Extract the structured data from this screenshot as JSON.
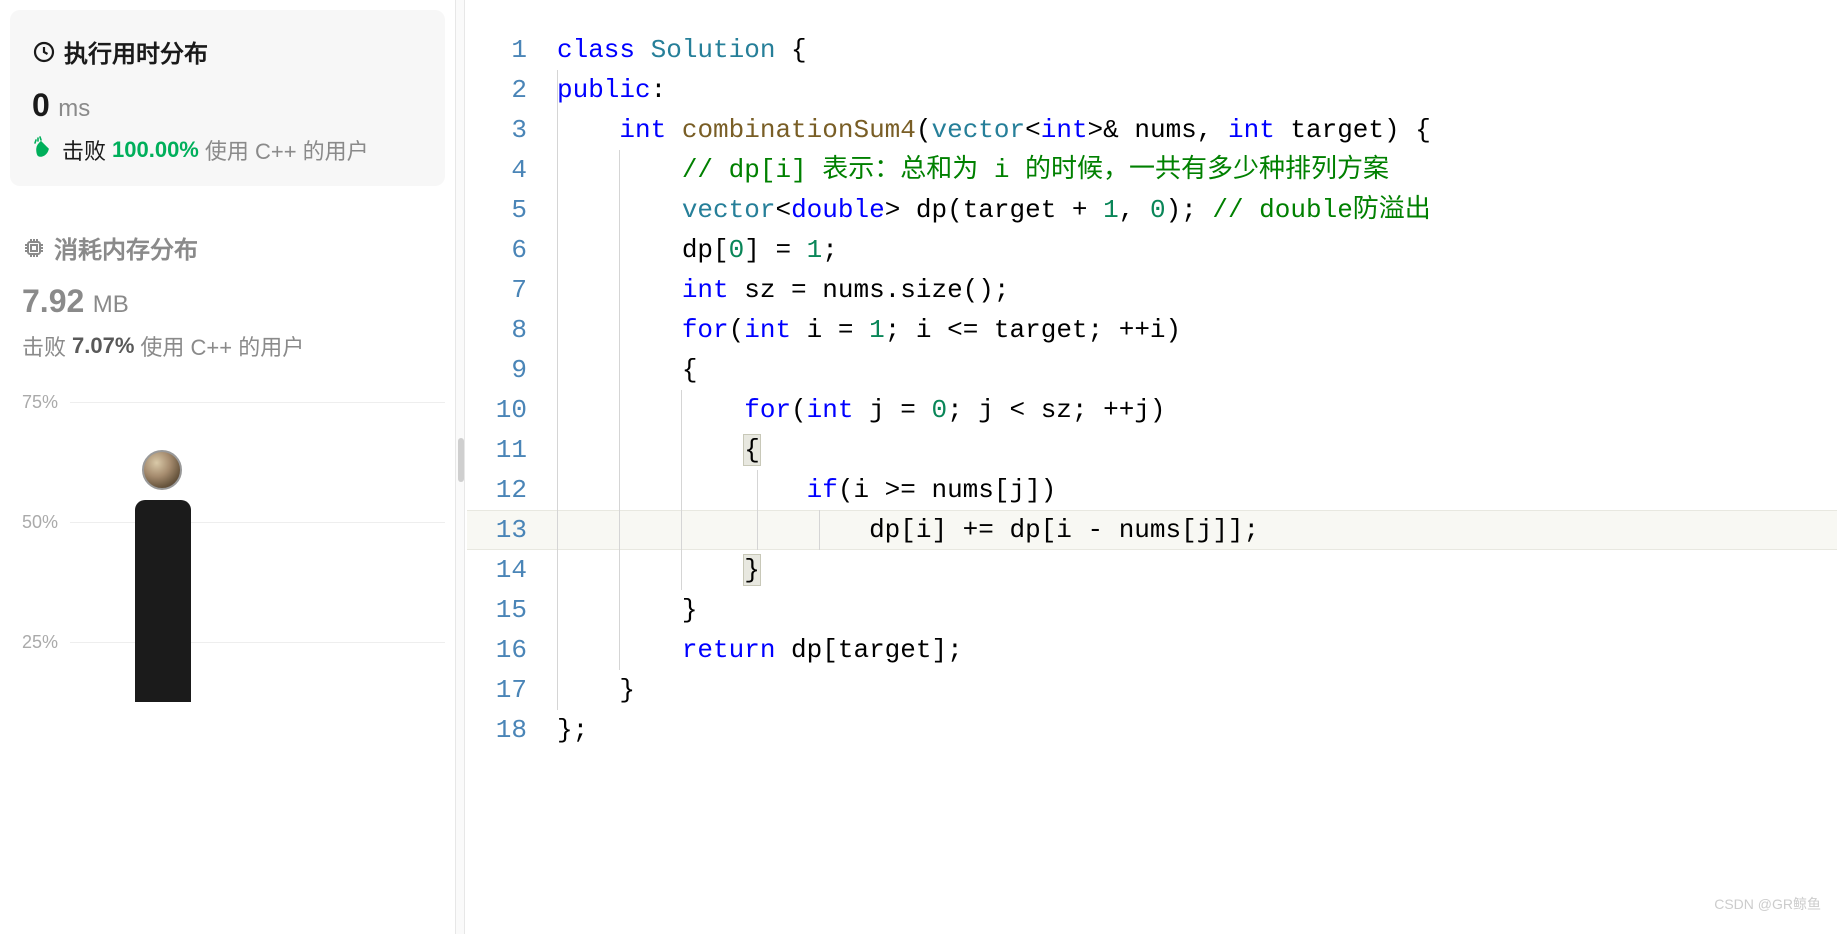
{
  "sidebar": {
    "runtime": {
      "title": "执行用时分布",
      "value": "0",
      "unit": "ms",
      "beats_label": "击败",
      "beats_pct": "100.00%",
      "beats_rest": "使用 C++ 的用户"
    },
    "memory": {
      "title": "消耗内存分布",
      "value": "7.92",
      "unit": "MB",
      "beats_label": "击败",
      "beats_pct": "7.07%",
      "beats_rest": "使用 C++ 的用户"
    },
    "chart": {
      "ticks": [
        "75%",
        "50%",
        "25%"
      ]
    }
  },
  "code": {
    "lines": {
      "l1": "1",
      "l2": "2",
      "l3": "3",
      "l4": "4",
      "l5": "5",
      "l6": "6",
      "l7": "7",
      "l8": "8",
      "l9": "9",
      "l10": "10",
      "l11": "11",
      "l12": "12",
      "l13": "13",
      "l14": "14",
      "l15": "15",
      "l16": "16",
      "l17": "17",
      "l18": "18"
    },
    "tokens": {
      "class": "class",
      "Solution": "Solution",
      "obrace": " {",
      "public": "public",
      "colon": ":",
      "int": "int",
      "fn": "combinationSum4",
      "vector": "vector",
      "lt": "<",
      "gt": ">",
      "amp_nums": "& nums, ",
      "target_decl": " target) {",
      "comment1": "// dp[i] 表示：总和为 i 的时候，一共有多少种排列方案",
      "double": "double",
      "dp_decl": "> dp(target + ",
      "one": "1",
      "zero": "0",
      "comma_sp": ", ",
      "paren_semi": "); ",
      "comment2": "// double防溢出",
      "dp0": "dp[",
      "brkt_eq": "] = ",
      "semi": ";",
      "sz_decl": " sz = nums.size();",
      "for": "for",
      "for1_a": "(",
      "for1_b": " i = ",
      "for1_c": "; i <= target; ++i)",
      "obrace2": "{",
      "for2_b": " j = ",
      "for2_c": "; j < sz; ++j)",
      "if": "if",
      "if_cond": "(i >= nums[j])",
      "dp_upd": "dp[i] += dp[i - nums[j]];",
      "cbrace": "}",
      "return": "return",
      "ret_expr": " dp[target];",
      "cbrace_semi": "};"
    }
  },
  "watermark": "CSDN @GR鲸鱼",
  "chart_data": {
    "type": "bar",
    "title": "执行用时分布",
    "xlabel": "",
    "ylabel": "%",
    "ylim": [
      0,
      100
    ],
    "categories": [
      "0 ms"
    ],
    "values": [
      72
    ]
  }
}
